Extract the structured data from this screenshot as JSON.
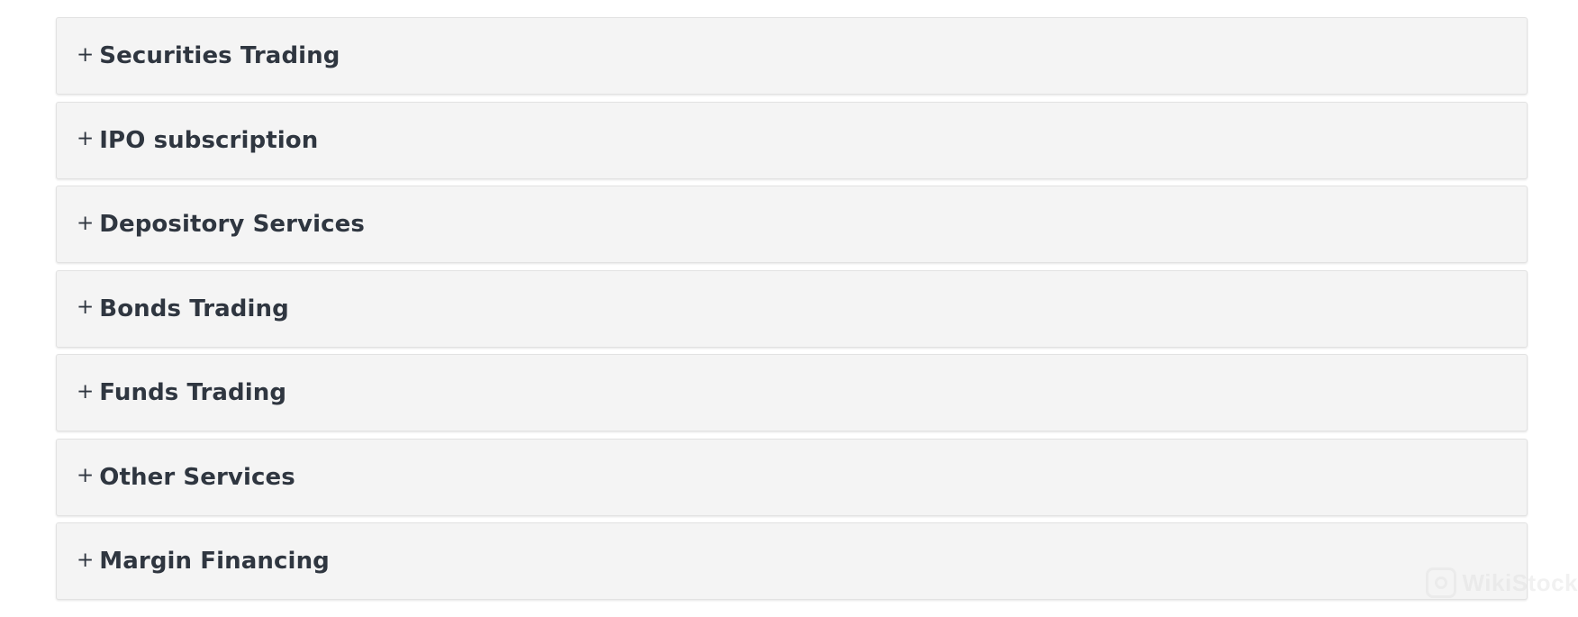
{
  "accordion": {
    "toggle_symbol": "+",
    "items": [
      {
        "label": "Securities Trading"
      },
      {
        "label": "IPO subscription"
      },
      {
        "label": "Depository Services"
      },
      {
        "label": "Bonds Trading"
      },
      {
        "label": "Funds Trading"
      },
      {
        "label": "Other Services"
      },
      {
        "label": "Margin Financing"
      }
    ]
  },
  "watermark": {
    "text": "WikiStock",
    "icon": "wikistock-logo-icon"
  },
  "colors": {
    "panel_background": "#f4f4f4",
    "panel_border": "#e2e2e2",
    "text": "#2f3640"
  }
}
